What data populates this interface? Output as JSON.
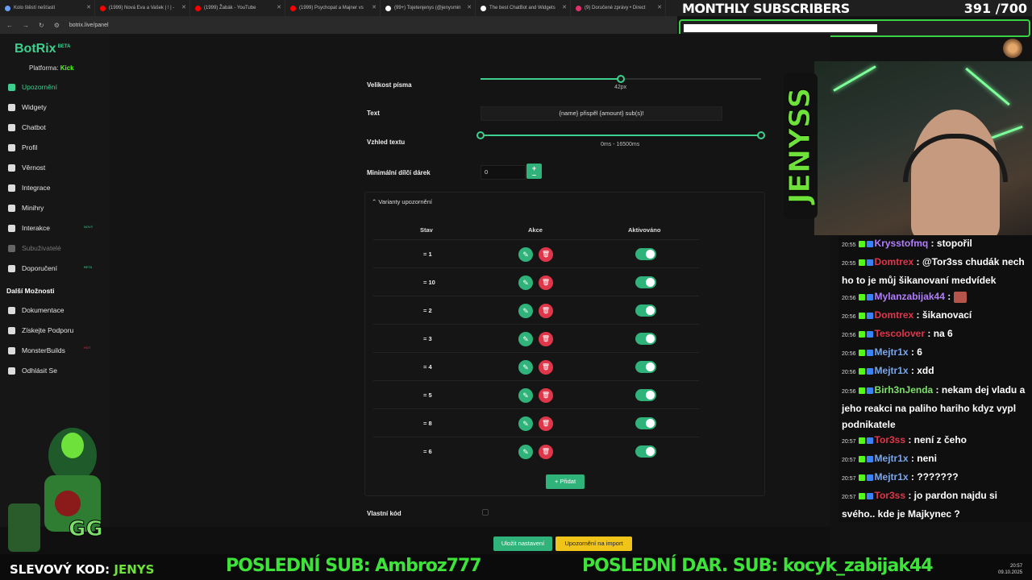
{
  "browser": {
    "tabs": [
      {
        "label": "Kolo štěstí nešťastí",
        "fav": "#6aa0f8"
      },
      {
        "label": "(1999) Nová Eva a Vašek | ! | -",
        "fav": "#ff0000"
      },
      {
        "label": "(1999) Žabák - YouTube",
        "fav": "#ff0000"
      },
      {
        "label": "(1999) Psychopat a Majner vs",
        "fav": "#ff0000"
      },
      {
        "label": "(99+) Tojetenjenys (@jenysmin",
        "fav": "#ffffff"
      },
      {
        "label": "The best ChatBot and Widgets",
        "fav": "#ffffff"
      },
      {
        "label": "(9) Doručené zprávy • Direct",
        "fav": "#e1306c"
      }
    ],
    "url": "botrix.live/panel"
  },
  "overlay_top": {
    "title": "MONTHLY SUBSCRIBERS",
    "count": "391",
    "goal": "/700",
    "progress": 0.56
  },
  "app": {
    "logo": "BotRix",
    "logo_badge": "BETA",
    "platform_label": "Platforma:",
    "platform_value": "Kick",
    "nav": [
      {
        "label": "Upozornění",
        "icon": "warning-icon",
        "state": "active"
      },
      {
        "label": "Widgety",
        "icon": "grid-icon",
        "state": ""
      },
      {
        "label": "Chatbot",
        "icon": "chat-icon",
        "state": ""
      },
      {
        "label": "Profil",
        "icon": "profile-icon",
        "state": ""
      },
      {
        "label": "Věrnost",
        "icon": "trophy-icon",
        "state": ""
      },
      {
        "label": "Integrace",
        "icon": "integration-icon",
        "state": ""
      },
      {
        "label": "Minihry",
        "icon": "gamepad-icon",
        "state": ""
      },
      {
        "label": "Interakce",
        "icon": "music-icon",
        "state": "",
        "badge": "NOVÝ"
      },
      {
        "label": "Subuživatelé",
        "icon": "users-icon",
        "state": "disabled"
      },
      {
        "label": "Doporučení",
        "icon": "referral-icon",
        "state": "",
        "badge": "BETA"
      }
    ],
    "section_more": "Další Možnosti",
    "nav_more": [
      {
        "label": "Dokumentace",
        "icon": "docs-icon"
      },
      {
        "label": "Získejte Podporu",
        "icon": "help-icon"
      },
      {
        "label": "MonsterBuilds",
        "icon": "monitor-icon",
        "badge": "HOT"
      },
      {
        "label": "Odhlásit Se",
        "icon": "logout-icon"
      }
    ]
  },
  "form": {
    "font_size_label": "Velikost písma",
    "font_size_value": "42px",
    "font_size_fraction": 0.5,
    "text_label": "Text",
    "text_value": "{name} přispěl {amount} sub(s)!",
    "appearance_label": "Vzhled textu",
    "appearance_value": "0ms - 16500ms",
    "min_gift_label": "Minimální dílčí dárek",
    "min_gift_value": "0",
    "stepper_symbols": "+\n–",
    "variants_title": "Varianty upozornění",
    "col_state": "Stav",
    "col_actions": "Akce",
    "col_active": "Aktivováno",
    "variants": [
      "= 1",
      "= 10",
      "= 2",
      "= 3",
      "= 4",
      "= 5",
      "= 8",
      "= 6"
    ],
    "add_label": "+ Přidat",
    "custom_code_label": "Vlastní kód",
    "save_label": "Uložit nastavení",
    "import_label": "Upozornění na import"
  },
  "chat": [
    {
      "time": "20:55",
      "user": "Krysstofmq",
      "color": "#b27dff",
      "text": "stopořil"
    },
    {
      "time": "20:55",
      "user": "Domtrex",
      "color": "#e0364a",
      "text": "@Tor3ss chudák nech ho to je můj šikanovaní medvídek"
    },
    {
      "time": "20:56",
      "user": "Mylanzabijak44",
      "color": "#b27dff",
      "text": ""
    },
    {
      "time": "20:56",
      "user": "Domtrex",
      "color": "#e0364a",
      "text": "šikanovací"
    },
    {
      "time": "20:56",
      "user": "Tescolover",
      "color": "#e0364a",
      "text": "na 6"
    },
    {
      "time": "20:56",
      "user": "Mejtr1x",
      "color": "#7aa6e8",
      "text": "6"
    },
    {
      "time": "20:56",
      "user": "Mejtr1x",
      "color": "#7aa6e8",
      "text": "xdd"
    },
    {
      "time": "20:56",
      "user": "Birh3nJenda",
      "color": "#7ee06a",
      "text": "nekam dej vladu a jeho reakci na paliho hariho kdyz vypl podnikatele"
    },
    {
      "time": "20:57",
      "user": "Tor3ss",
      "color": "#e0364a",
      "text": "není z čeho"
    },
    {
      "time": "20:57",
      "user": "Mejtr1x",
      "color": "#7aa6e8",
      "text": "neni"
    },
    {
      "time": "20:57",
      "user": "Mejtr1x",
      "color": "#7aa6e8",
      "text": "???????"
    },
    {
      "time": "20:57",
      "user": "Tor3ss",
      "color": "#e0364a",
      "text": "jo pardon najdu si svého.. kde je Majkynec ?"
    }
  ],
  "overlay_bottom": {
    "coupon_label": "SLEVOVÝ KOD:",
    "coupon_code": "JENYS",
    "last_sub": "POSLEDNÍ SUB: Ambroz777",
    "last_gift": "POSLEDNÍ DAR. SUB: kocyk_zabijak44",
    "side_logo": "JENYSS",
    "clock_time": "20:57",
    "clock_date": "09.10.2025"
  }
}
